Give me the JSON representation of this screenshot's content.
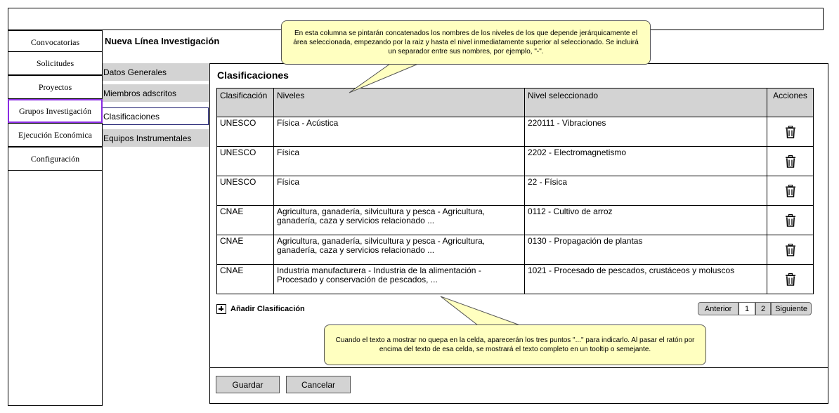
{
  "menu": {
    "items": [
      {
        "label": "Convocatorias"
      },
      {
        "label": "Solicitudes"
      },
      {
        "label": "Proyectos"
      },
      {
        "label": "Grupos Investigación"
      },
      {
        "label": "Ejecución Económica"
      },
      {
        "label": "Configuración"
      }
    ],
    "active": "Grupos Investigación"
  },
  "page": {
    "title": "Nueva Línea Investigación"
  },
  "subtabs": [
    {
      "label": "Datos Generales"
    },
    {
      "label": "Miembros adscritos"
    },
    {
      "label": "Clasificaciones"
    },
    {
      "label": "Equipos Instrumentales"
    }
  ],
  "section": {
    "title": "Clasificaciones"
  },
  "table": {
    "headers": {
      "clasificacion": "Clasificación",
      "niveles": "Niveles",
      "nivel": "Nivel seleccionado",
      "acciones": "Acciones"
    },
    "rows": [
      {
        "clasificacion": "UNESCO",
        "niveles": "Física - Acústica",
        "nivel": "220111 - Vibraciones"
      },
      {
        "clasificacion": "UNESCO",
        "niveles": "Física",
        "nivel": "2202 - Electromagnetismo"
      },
      {
        "clasificacion": "UNESCO",
        "niveles": "Física",
        "nivel": "22 - Física"
      },
      {
        "clasificacion": "CNAE",
        "niveles": "Agricultura, ganadería, silvicultura y pesca - Agricultura, ganadería, caza y servicios relacionado ...",
        "nivel": "0112 - Cultivo de arroz"
      },
      {
        "clasificacion": "CNAE",
        "niveles": "Agricultura, ganadería, silvicultura y pesca - Agricultura, ganadería, caza y servicios relacionado ...",
        "nivel": "0130 - Propagación de plantas"
      },
      {
        "clasificacion": "CNAE",
        "niveles": "Industria manufacturera - Industria de la alimentación - Procesado y conservación de pescados, ...",
        "nivel": "1021 - Procesado de pescados, crustáceos y moluscos"
      }
    ],
    "row_icon": "trash-icon"
  },
  "add": {
    "label": "Añadir Clasificación",
    "icon": "plus-square-icon"
  },
  "pager": {
    "prev": "Anterior",
    "page1": "1",
    "page2": "2",
    "next": "Siguiente"
  },
  "footer": {
    "save": "Guardar",
    "cancel": "Cancelar"
  },
  "notes": {
    "top": "En esta columna se pintarán concatenados los nombres de los niveles de los que depende jerárquicamente el área seleccionada, empezando por la raiz y hasta el nivel inmediatamente superior al seleccionado. Se incluirá un separador entre sus nombres, por ejemplo, \"-\".",
    "bottom": "Cuando el texto a mostrar no quepa en la celda, aparecerán los tres puntos \"...\" para indicarlo. Al pasar el ratón por encima del texto de esa celda, se mostrará el texto completo en un tooltip o semejante."
  },
  "colors": {
    "tab_bg": "#d3d3d3",
    "active_menu_border": "#8a2be2",
    "note_bg": "#ffffc0"
  }
}
